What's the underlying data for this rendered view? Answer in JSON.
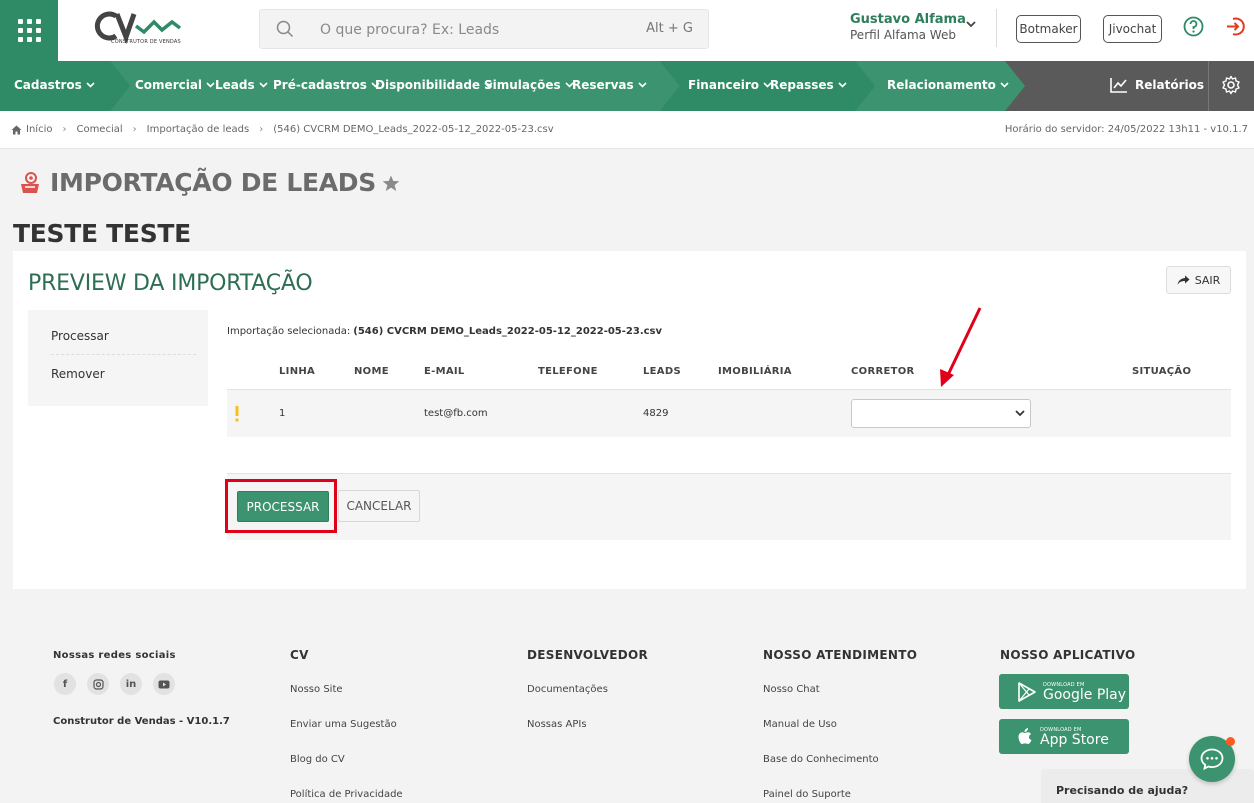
{
  "brand": {
    "logo_text": "CV",
    "logo_subtitle": "CONSTRUTOR DE VENDAS"
  },
  "header": {
    "search_placeholder": "O que procura? Ex: Leads",
    "search_shortcut": "Alt + G",
    "user_name": "Gustavo Alfama",
    "user_profile": "Perfil Alfama Web",
    "botmaker": "Botmaker",
    "jivochat": "Jivochat"
  },
  "nav": {
    "items": [
      "Cadastros",
      "Comercial",
      "Leads",
      "Pré-cadastros",
      "Disponibilidade",
      "Simulações",
      "Reservas",
      "Financeiro",
      "Repasses",
      "Relacionamento"
    ],
    "reports": "Relatórios"
  },
  "breadcrumb": {
    "items": [
      "Início",
      "Comecial",
      "Importação de leads",
      "(546) CVCRM DEMO_Leads_2022-05-12_2022-05-23.csv"
    ],
    "server_time": "Horário do servidor: 24/05/2022 13h11 - v10.1.7"
  },
  "page": {
    "title": "IMPORTAÇÃO DE LEADS",
    "subtitle": "TESTE TESTE"
  },
  "preview": {
    "title": "PREVIEW DA IMPORTAÇÃO",
    "exit_label": "SAIR",
    "side_menu": [
      "Processar",
      "Remover"
    ],
    "selected_label": "Importação selecionada:",
    "selected_file": "(546) CVCRM DEMO_Leads_2022-05-12_2022-05-23.csv",
    "columns": [
      "LINHA",
      "NOME",
      "E-MAIL",
      "TELEFONE",
      "LEADS",
      "IMOBILIÁRIA",
      "CORRETOR",
      "SITUAÇÃO"
    ],
    "rows": [
      {
        "warning": "!",
        "linha": "1",
        "nome": "",
        "email": "test@fb.com",
        "telefone": "",
        "leads": "4829",
        "imobiliaria": "",
        "corretor": "",
        "situacao": ""
      }
    ],
    "process_button": "PROCESSAR",
    "cancel_button": "CANCELAR"
  },
  "footer": {
    "social_title": "Nossas redes sociais",
    "social_icons": [
      "f",
      "ig",
      "in",
      "yt"
    ],
    "version": "Construtor de Vendas - V10.1.7",
    "cv": {
      "title": "CV",
      "links": [
        "Nosso Site",
        "Enviar uma Sugestão",
        "Blog do CV",
        "Política de Privacidade"
      ]
    },
    "dev": {
      "title": "DESENVOLVEDOR",
      "links": [
        "Documentações",
        "Nossas APIs"
      ]
    },
    "support": {
      "title": "NOSSO ATENDIMENTO",
      "links": [
        "Nosso Chat",
        "Manual de Uso",
        "Base do Conhecimento",
        "Painel do Suporte"
      ]
    },
    "app": {
      "title": "NOSSO APLICATIVO",
      "google_small": "DOWNLOAD EM",
      "google_big": "Google Play",
      "apple_small": "DOWNLOAD EM",
      "apple_big": "App Store"
    }
  },
  "help": {
    "text": "Precisando de ajuda?"
  },
  "colors": {
    "brand_green": "#2e8b66",
    "title_green": "#2e6e55",
    "highlight_red": "#e0001a",
    "warning_yellow": "#f2c21b"
  }
}
